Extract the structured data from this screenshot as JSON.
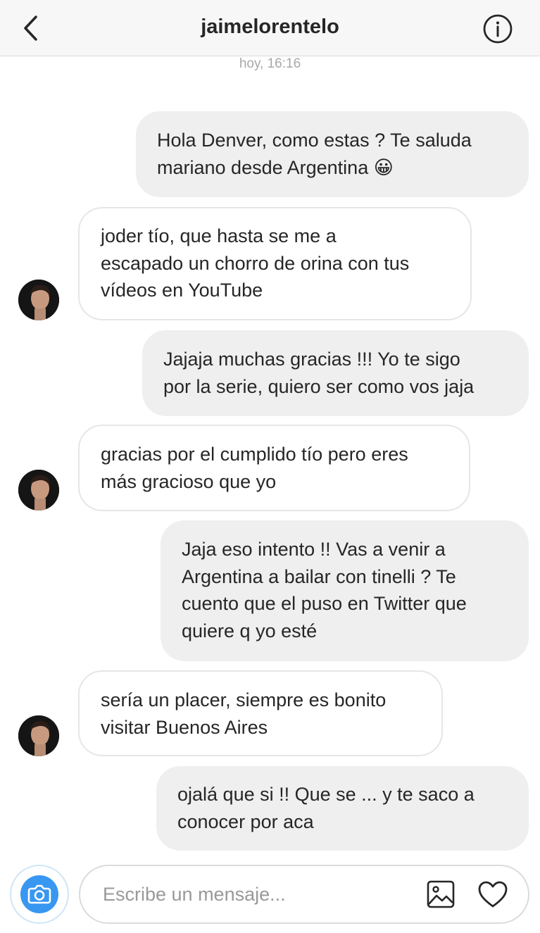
{
  "header": {
    "title": "jaimelorentelo",
    "back_icon": "chevron-left-icon",
    "info_icon": "info-circle-icon"
  },
  "timestamp": "hoy, 16:16",
  "messages": [
    {
      "direction": "sent",
      "text": "Hola Denver, como estas ? Te saluda\nmariano desde Argentina 😀"
    },
    {
      "direction": "received",
      "text": "joder tío, que hasta se me a\nescapado un chorro de orina con tus\nvídeos en YouTube"
    },
    {
      "direction": "sent",
      "text": "Jajaja muchas gracias !!! Yo te sigo\npor la serie, quiero ser como vos jaja"
    },
    {
      "direction": "received",
      "text": "gracias por el cumplido tío pero eres\nmás gracioso que yo"
    },
    {
      "direction": "sent",
      "text": "Jaja eso intento !! Vas a venir a\nArgentina a bailar con tinelli ? Te\ncuento que el puso en Twitter que\nquiere q yo esté"
    },
    {
      "direction": "received",
      "text": "sería un placer, siempre es bonito\nvisitar Buenos Aires"
    },
    {
      "direction": "sent",
      "text": "ojalá que si !! Que se ... y te saco a\nconocer por aca"
    }
  ],
  "composer": {
    "placeholder": "Escribe un mensaje...",
    "value": "",
    "camera_icon": "camera-icon",
    "gallery_icon": "image-gallery-icon",
    "like_icon": "heart-icon"
  },
  "colors": {
    "accent": "#3897f0",
    "sent_bubble": "#efefef",
    "received_border": "#e6e6e6",
    "timestamp": "#a8a8a8"
  }
}
